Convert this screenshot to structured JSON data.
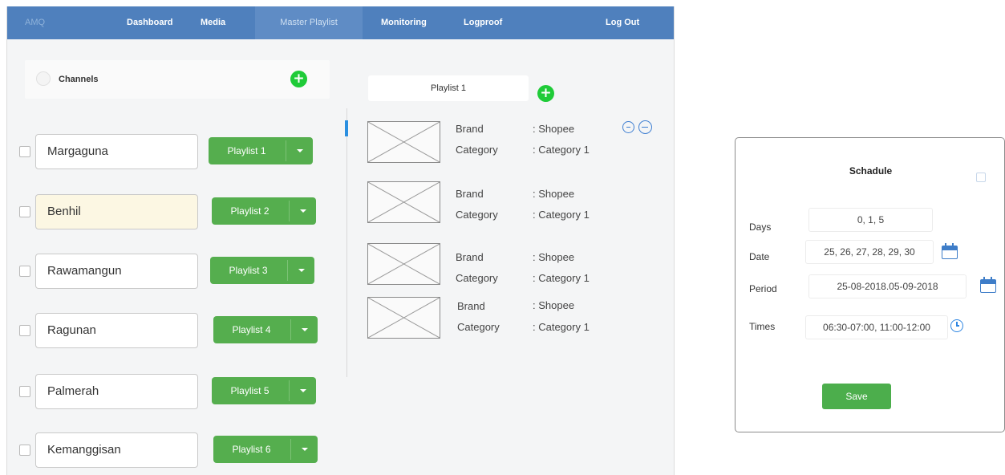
{
  "nav": {
    "logo": "AMQ",
    "items": [
      "Dashboard",
      "Media",
      "Master Playlist",
      "Monitoring",
      "Logproof"
    ],
    "logout": "Log Out",
    "active_item": "Master Playlist"
  },
  "channels": {
    "title": "Channels",
    "rows": [
      {
        "name": "Margaguna",
        "playlist": "Playlist 1"
      },
      {
        "name": "Benhil",
        "playlist": "Playlist 2"
      },
      {
        "name": "Rawamangun",
        "playlist": "Playlist 3"
      },
      {
        "name": "Ragunan",
        "playlist": "Playlist 4"
      },
      {
        "name": "Palmerah",
        "playlist": "Playlist 5"
      },
      {
        "name": "Kemanggisan",
        "playlist": "Playlist 6"
      }
    ]
  },
  "playlist": {
    "name": "Playlist 1",
    "items": [
      {
        "brand_label": "Brand",
        "brand_value": ": Shopee",
        "category_label": "Category",
        "category_value": ": Category 1"
      },
      {
        "brand_label": "Brand",
        "brand_value": ": Shopee",
        "category_label": "Category",
        "category_value": ": Category 1"
      },
      {
        "brand_label": "Brand",
        "brand_value": ": Shopee",
        "category_label": "Category",
        "category_value": ": Category 1"
      },
      {
        "brand_label": "Brand",
        "brand_value": ": Shopee",
        "category_label": "Category",
        "category_value": ": Category 1"
      }
    ]
  },
  "schedule": {
    "title": "Schadule",
    "days_label": "Days",
    "days_value": "0, 1, 5",
    "date_label": "Date",
    "date_value": "25, 26, 27, 28, 29, 30",
    "period_label": "Period",
    "period_value": "25-08-2018.05-09-2018",
    "times_label": "Times",
    "times_value": "06:30-07:00, 11:00-12:00",
    "save_label": "Save"
  },
  "colors": {
    "topbar": "#4f80bd",
    "accent_green": "#55ae4e",
    "add_green": "#1fcb38",
    "icon_blue": "#3e7dc8"
  },
  "icons": [
    "add-icon",
    "calendar-icon",
    "clock-icon",
    "remove-icon",
    "close-icon",
    "dropdown-caret-icon",
    "image-placeholder-icon"
  ]
}
